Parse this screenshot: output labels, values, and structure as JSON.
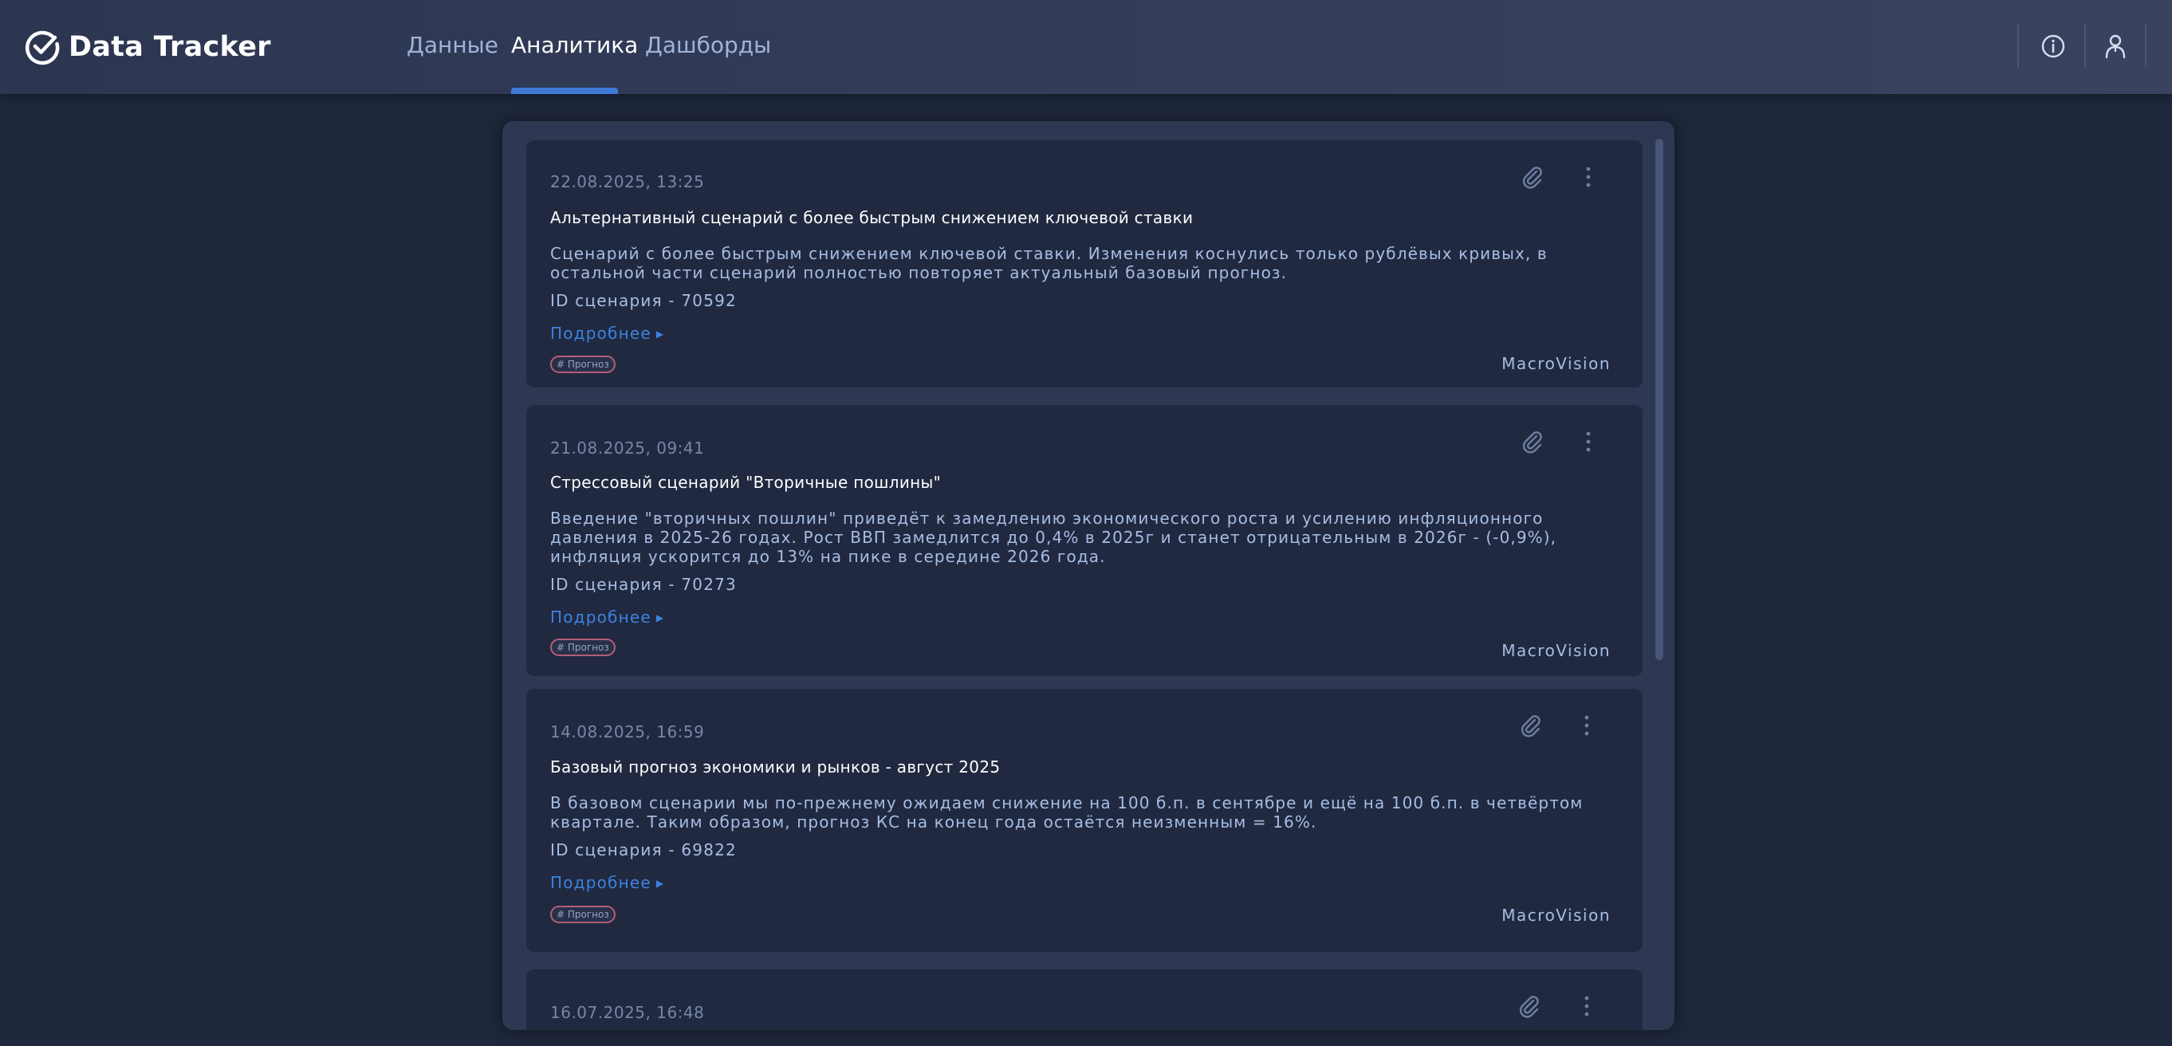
{
  "app": {
    "title": "Data Tracker",
    "accent_color": "#3e7bd6"
  },
  "nav": {
    "items": [
      {
        "label": "Данные",
        "active": false
      },
      {
        "label": "Аналитика",
        "active": true
      },
      {
        "label": "Дашборды",
        "active": false
      }
    ]
  },
  "header_icons": [
    "info-icon",
    "user-icon"
  ],
  "cards": [
    {
      "date": "22.08.2025, 13:25",
      "title": "Альтернативный сценарий с более быстрым снижением ключевой ставки",
      "description": "Сценарий с более быстрым снижением ключевой ставки. Изменения коснулись только рублёвых кривых, в остальной части сценарий полностью повторяет актуальный базовый прогноз.",
      "scenario_id": "ID сценария - 70592",
      "more_label": "Подробнее",
      "tag": "# Прогноз",
      "source": "MacroVision"
    },
    {
      "date": "21.08.2025, 09:41",
      "title": "Стрессовый сценарий \"Вторичные пошлины\"",
      "description": "Введение \"вторичных пошлин\" приведёт к замедлению экономического роста и усилению инфляционного давления в 2025-26 годах. Рост ВВП замедлится до 0,4% в 2025г и станет отрицательным в 2026г - (-0,9%), инфляция ускорится до 13% на пике в середине 2026 года.",
      "scenario_id": "ID сценария - 70273",
      "more_label": "Подробнее",
      "tag": "# Прогноз",
      "source": "MacroVision"
    },
    {
      "date": "14.08.2025, 16:59",
      "title": "Базовый прогноз экономики и рынков - август 2025",
      "description": "В базовом сценарии мы по-прежнему ожидаем снижение на 100 б.п. в сентябре  и ещё на 100 б.п. в четвёртом квартале. Таким образом, прогноз КС на конец года остаётся неизменным = 16%.",
      "scenario_id": "ID сценария - 69822",
      "more_label": "Подробнее",
      "tag": "# Прогноз",
      "source": "MacroVision"
    },
    {
      "date": "16.07.2025, 16:48"
    }
  ]
}
